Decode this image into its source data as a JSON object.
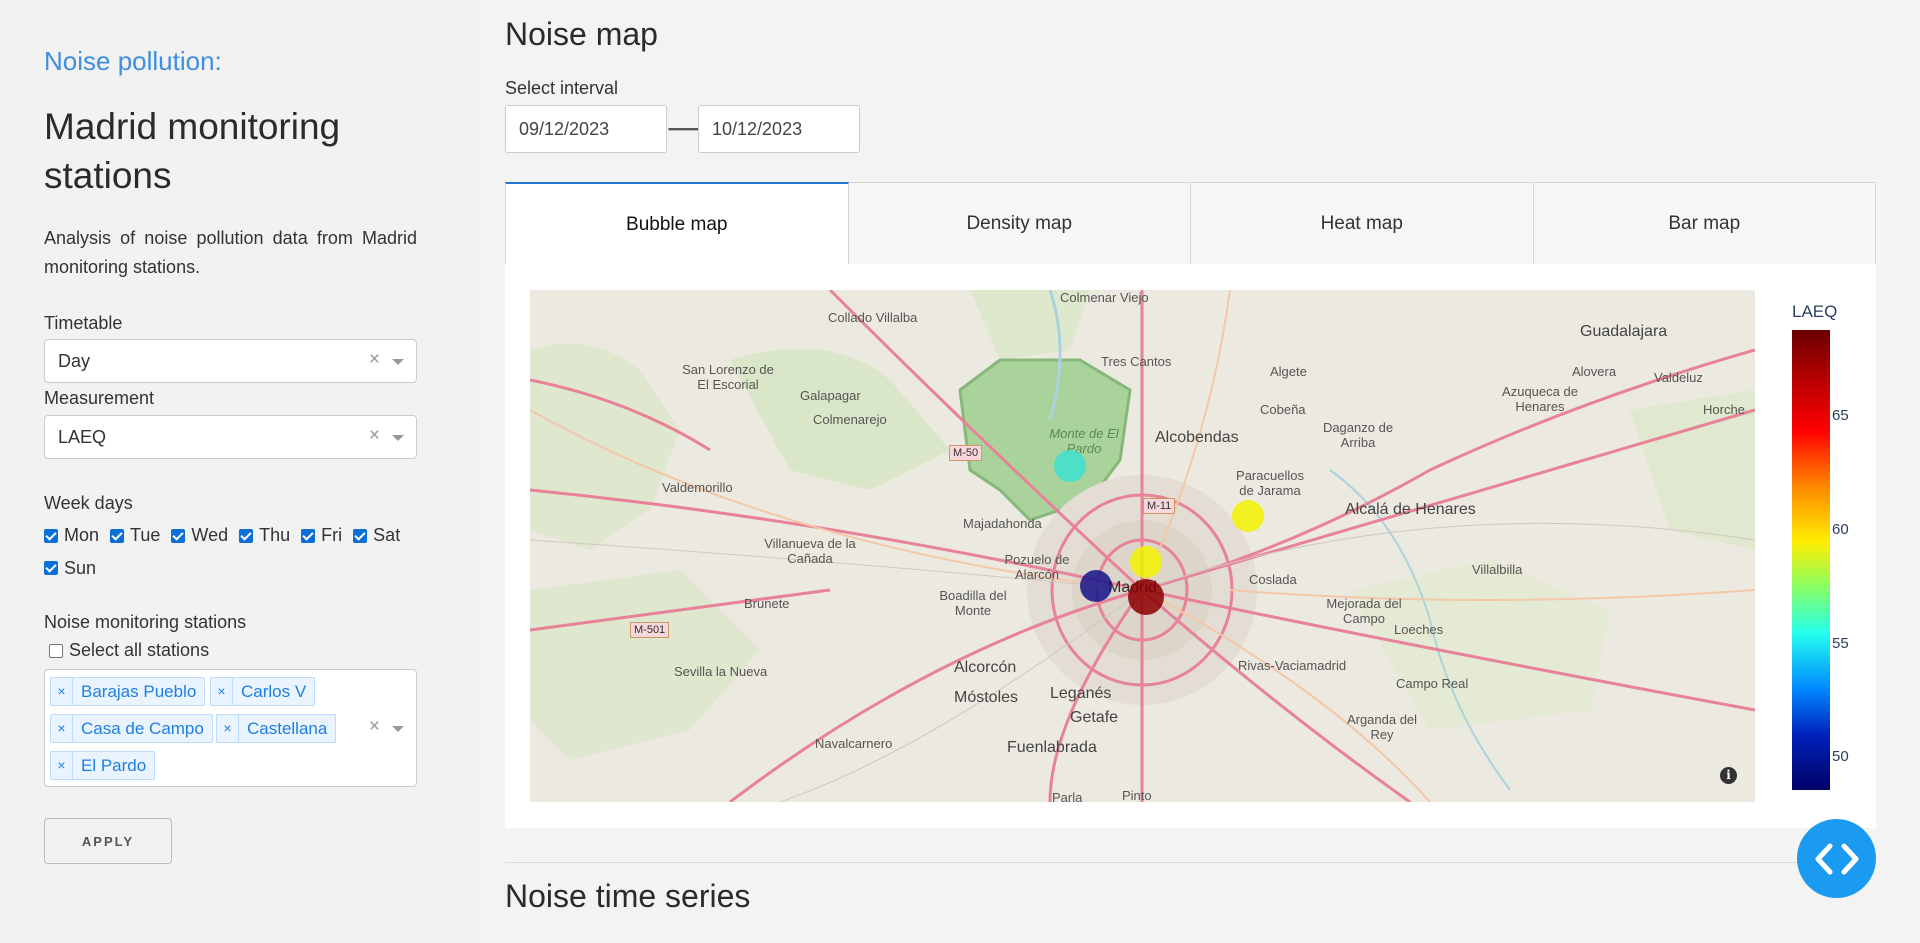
{
  "sidebar": {
    "subtitle": "Noise pollution:",
    "title": "Madrid monitoring stations",
    "description": "Analysis of noise pollution data from Madrid monitoring stations.",
    "timetable": {
      "label": "Timetable",
      "value": "Day"
    },
    "measurement": {
      "label": "Measurement",
      "value": "LAEQ"
    },
    "week_days": {
      "label": "Week days",
      "days": [
        {
          "label": "Mon",
          "checked": true
        },
        {
          "label": "Tue",
          "checked": true
        },
        {
          "label": "Wed",
          "checked": true
        },
        {
          "label": "Thu",
          "checked": true
        },
        {
          "label": "Fri",
          "checked": true
        },
        {
          "label": "Sat",
          "checked": true
        },
        {
          "label": "Sun",
          "checked": true
        }
      ]
    },
    "stations": {
      "label": "Noise monitoring stations",
      "select_all_label": "Select all stations",
      "selected": [
        "Barajas Pueblo",
        "Carlos V",
        "Casa de Campo",
        "Castellana",
        "El Pardo"
      ]
    },
    "apply_label": "APPLY"
  },
  "main": {
    "title": "Noise map",
    "interval_label": "Select interval",
    "start_date": "09/12/2023",
    "end_date": "10/12/2023",
    "tabs": [
      {
        "label": "Bubble map",
        "active": true
      },
      {
        "label": "Density map",
        "active": false
      },
      {
        "label": "Heat map",
        "active": false
      },
      {
        "label": "Bar map",
        "active": false
      }
    ],
    "map": {
      "places": [
        "Colmenar Viejo",
        "Collado Villalba",
        "San Lorenzo de El Escorial",
        "Galapagar",
        "Colmenarejo",
        "Tres Cantos",
        "Monte de El Pardo",
        "Algete",
        "Guadalajara",
        "Alovera",
        "Azuqueca de Henares",
        "Valdeluz",
        "Horche",
        "Cobeña",
        "Daganzo de Arriba",
        "Alcobendas",
        "Paracuellos de Jarama",
        "Alcalá de Henares",
        "Valdemorillo",
        "Majadahonda",
        "Villanueva de la Cañada",
        "Pozuelo de Alarcón",
        "Madrid",
        "Coslada",
        "Villalbilla",
        "Brunete",
        "Boadilla del Monte",
        "Mejorada del Campo",
        "Loeches",
        "Sevilla la Nueva",
        "Alcorcón",
        "Rivas-Vaciamadrid",
        "Campo Real",
        "Móstoles",
        "Leganés",
        "Getafe",
        "Arganda del Rey",
        "Navalcarnero",
        "Fuenlabrada",
        "Parla",
        "Pinto"
      ],
      "road_signs": [
        "M-50",
        "M-11",
        "M-501"
      ],
      "color_bar": {
        "title": "LAEQ",
        "ticks": [
          "65",
          "60",
          "55",
          "50"
        ]
      },
      "bubbles": [
        {
          "station": "El Pardo",
          "laeq": 56.5,
          "color": "#3de0d0"
        },
        {
          "station": "Barajas Pueblo",
          "laeq": 61.0,
          "color": "#f2f200"
        },
        {
          "station": "Castellana",
          "laeq": 61.0,
          "color": "#f2f200"
        },
        {
          "station": "Casa de Campo",
          "laeq": 49.5,
          "color": "#14148a"
        },
        {
          "station": "Carlos V",
          "laeq": 68.5,
          "color": "#8b0000"
        }
      ]
    },
    "time_series_title": "Noise time series"
  }
}
